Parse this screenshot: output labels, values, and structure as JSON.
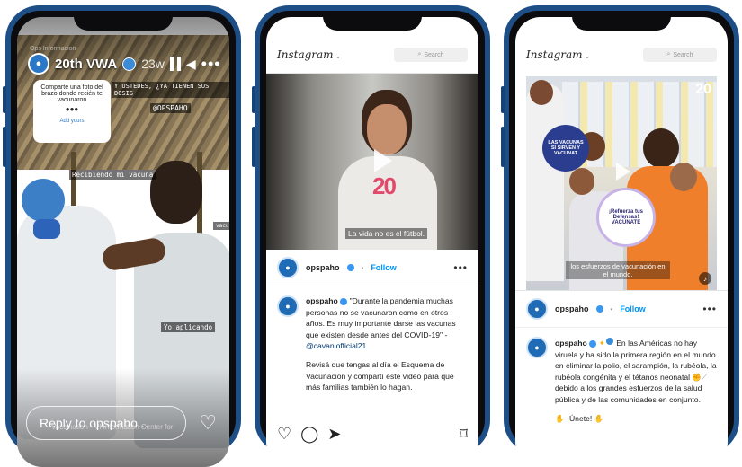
{
  "phone1": {
    "username": "20th VWA",
    "time": "23w",
    "faint_header": "Ops Informacion",
    "question_card": {
      "text": "Comparte una foto del brazo donde recién te vacunaron",
      "link": "Add yours"
    },
    "overlay_top": "Y USTEDES, ¿YA TIENEN SUS DOSIS",
    "overlay_handle": "@OPSPAHO",
    "overlay_left": "Recibiendo mi vacuna",
    "overlay_right": "Yo aplicando",
    "overlay_far_right": "vacunas",
    "faint_caption": "Vaccination - VI Information Center for",
    "reply_placeholder": "Reply to opspaho..."
  },
  "phone2": {
    "logo": "Instagram",
    "search_placeholder": "Search",
    "video_subtitle": "La vida no es el fútbol.",
    "username": "opspaho",
    "follow": "Follow",
    "caption_user": "opspaho",
    "caption_p1": "\"Durante la pandemia muchas personas no se vacunaron como en otros años. Es muy importante darse las vacunas que existen desde antes del COVID-19\" -",
    "caption_mention": "@cavaniofficial21",
    "caption_p2": "Revisá que tengas al día el Esquema de Vacunación y compartí este video para que más familias también lo hagan."
  },
  "phone3": {
    "logo": "Instagram",
    "search_placeholder": "Search",
    "sign_left": "LAS VACUNAS SI SIRVEN Y VACUNAT",
    "sign_right": "¡Refuerza tus Defensas! VACÚNATE",
    "video_subtitle": "los esfuerzos de vacunación en el mundo.",
    "banner_digit": "20",
    "username": "opspaho",
    "follow": "Follow",
    "caption_user": "opspaho",
    "caption_text": "En las Américas no hay viruela y ha sido la primera región en el mundo en eliminar la polio, el sarampión, la rubéola, la rubéola congénita y el tétanos neonatal",
    "caption_text2": "debido a los grandes esfuerzos de la salud pública y de las comunidades en conjunto.",
    "cta": "¡Únete!"
  }
}
